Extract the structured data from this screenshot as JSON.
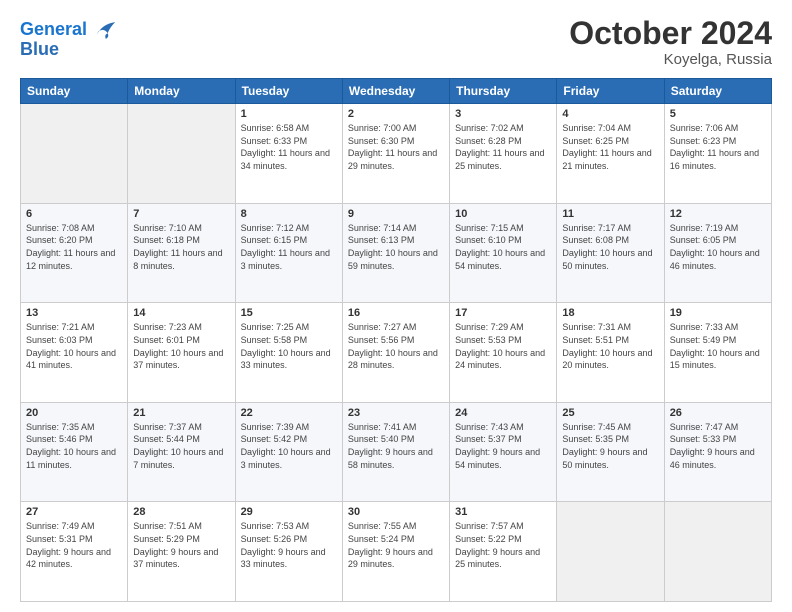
{
  "header": {
    "logo_line1": "General",
    "logo_line2": "Blue",
    "month": "October 2024",
    "location": "Koyelga, Russia"
  },
  "weekdays": [
    "Sunday",
    "Monday",
    "Tuesday",
    "Wednesday",
    "Thursday",
    "Friday",
    "Saturday"
  ],
  "weeks": [
    [
      {
        "day": "",
        "info": ""
      },
      {
        "day": "",
        "info": ""
      },
      {
        "day": "1",
        "info": "Sunrise: 6:58 AM\nSunset: 6:33 PM\nDaylight: 11 hours and 34 minutes."
      },
      {
        "day": "2",
        "info": "Sunrise: 7:00 AM\nSunset: 6:30 PM\nDaylight: 11 hours and 29 minutes."
      },
      {
        "day": "3",
        "info": "Sunrise: 7:02 AM\nSunset: 6:28 PM\nDaylight: 11 hours and 25 minutes."
      },
      {
        "day": "4",
        "info": "Sunrise: 7:04 AM\nSunset: 6:25 PM\nDaylight: 11 hours and 21 minutes."
      },
      {
        "day": "5",
        "info": "Sunrise: 7:06 AM\nSunset: 6:23 PM\nDaylight: 11 hours and 16 minutes."
      }
    ],
    [
      {
        "day": "6",
        "info": "Sunrise: 7:08 AM\nSunset: 6:20 PM\nDaylight: 11 hours and 12 minutes."
      },
      {
        "day": "7",
        "info": "Sunrise: 7:10 AM\nSunset: 6:18 PM\nDaylight: 11 hours and 8 minutes."
      },
      {
        "day": "8",
        "info": "Sunrise: 7:12 AM\nSunset: 6:15 PM\nDaylight: 11 hours and 3 minutes."
      },
      {
        "day": "9",
        "info": "Sunrise: 7:14 AM\nSunset: 6:13 PM\nDaylight: 10 hours and 59 minutes."
      },
      {
        "day": "10",
        "info": "Sunrise: 7:15 AM\nSunset: 6:10 PM\nDaylight: 10 hours and 54 minutes."
      },
      {
        "day": "11",
        "info": "Sunrise: 7:17 AM\nSunset: 6:08 PM\nDaylight: 10 hours and 50 minutes."
      },
      {
        "day": "12",
        "info": "Sunrise: 7:19 AM\nSunset: 6:05 PM\nDaylight: 10 hours and 46 minutes."
      }
    ],
    [
      {
        "day": "13",
        "info": "Sunrise: 7:21 AM\nSunset: 6:03 PM\nDaylight: 10 hours and 41 minutes."
      },
      {
        "day": "14",
        "info": "Sunrise: 7:23 AM\nSunset: 6:01 PM\nDaylight: 10 hours and 37 minutes."
      },
      {
        "day": "15",
        "info": "Sunrise: 7:25 AM\nSunset: 5:58 PM\nDaylight: 10 hours and 33 minutes."
      },
      {
        "day": "16",
        "info": "Sunrise: 7:27 AM\nSunset: 5:56 PM\nDaylight: 10 hours and 28 minutes."
      },
      {
        "day": "17",
        "info": "Sunrise: 7:29 AM\nSunset: 5:53 PM\nDaylight: 10 hours and 24 minutes."
      },
      {
        "day": "18",
        "info": "Sunrise: 7:31 AM\nSunset: 5:51 PM\nDaylight: 10 hours and 20 minutes."
      },
      {
        "day": "19",
        "info": "Sunrise: 7:33 AM\nSunset: 5:49 PM\nDaylight: 10 hours and 15 minutes."
      }
    ],
    [
      {
        "day": "20",
        "info": "Sunrise: 7:35 AM\nSunset: 5:46 PM\nDaylight: 10 hours and 11 minutes."
      },
      {
        "day": "21",
        "info": "Sunrise: 7:37 AM\nSunset: 5:44 PM\nDaylight: 10 hours and 7 minutes."
      },
      {
        "day": "22",
        "info": "Sunrise: 7:39 AM\nSunset: 5:42 PM\nDaylight: 10 hours and 3 minutes."
      },
      {
        "day": "23",
        "info": "Sunrise: 7:41 AM\nSunset: 5:40 PM\nDaylight: 9 hours and 58 minutes."
      },
      {
        "day": "24",
        "info": "Sunrise: 7:43 AM\nSunset: 5:37 PM\nDaylight: 9 hours and 54 minutes."
      },
      {
        "day": "25",
        "info": "Sunrise: 7:45 AM\nSunset: 5:35 PM\nDaylight: 9 hours and 50 minutes."
      },
      {
        "day": "26",
        "info": "Sunrise: 7:47 AM\nSunset: 5:33 PM\nDaylight: 9 hours and 46 minutes."
      }
    ],
    [
      {
        "day": "27",
        "info": "Sunrise: 7:49 AM\nSunset: 5:31 PM\nDaylight: 9 hours and 42 minutes."
      },
      {
        "day": "28",
        "info": "Sunrise: 7:51 AM\nSunset: 5:29 PM\nDaylight: 9 hours and 37 minutes."
      },
      {
        "day": "29",
        "info": "Sunrise: 7:53 AM\nSunset: 5:26 PM\nDaylight: 9 hours and 33 minutes."
      },
      {
        "day": "30",
        "info": "Sunrise: 7:55 AM\nSunset: 5:24 PM\nDaylight: 9 hours and 29 minutes."
      },
      {
        "day": "31",
        "info": "Sunrise: 7:57 AM\nSunset: 5:22 PM\nDaylight: 9 hours and 25 minutes."
      },
      {
        "day": "",
        "info": ""
      },
      {
        "day": "",
        "info": ""
      }
    ]
  ]
}
